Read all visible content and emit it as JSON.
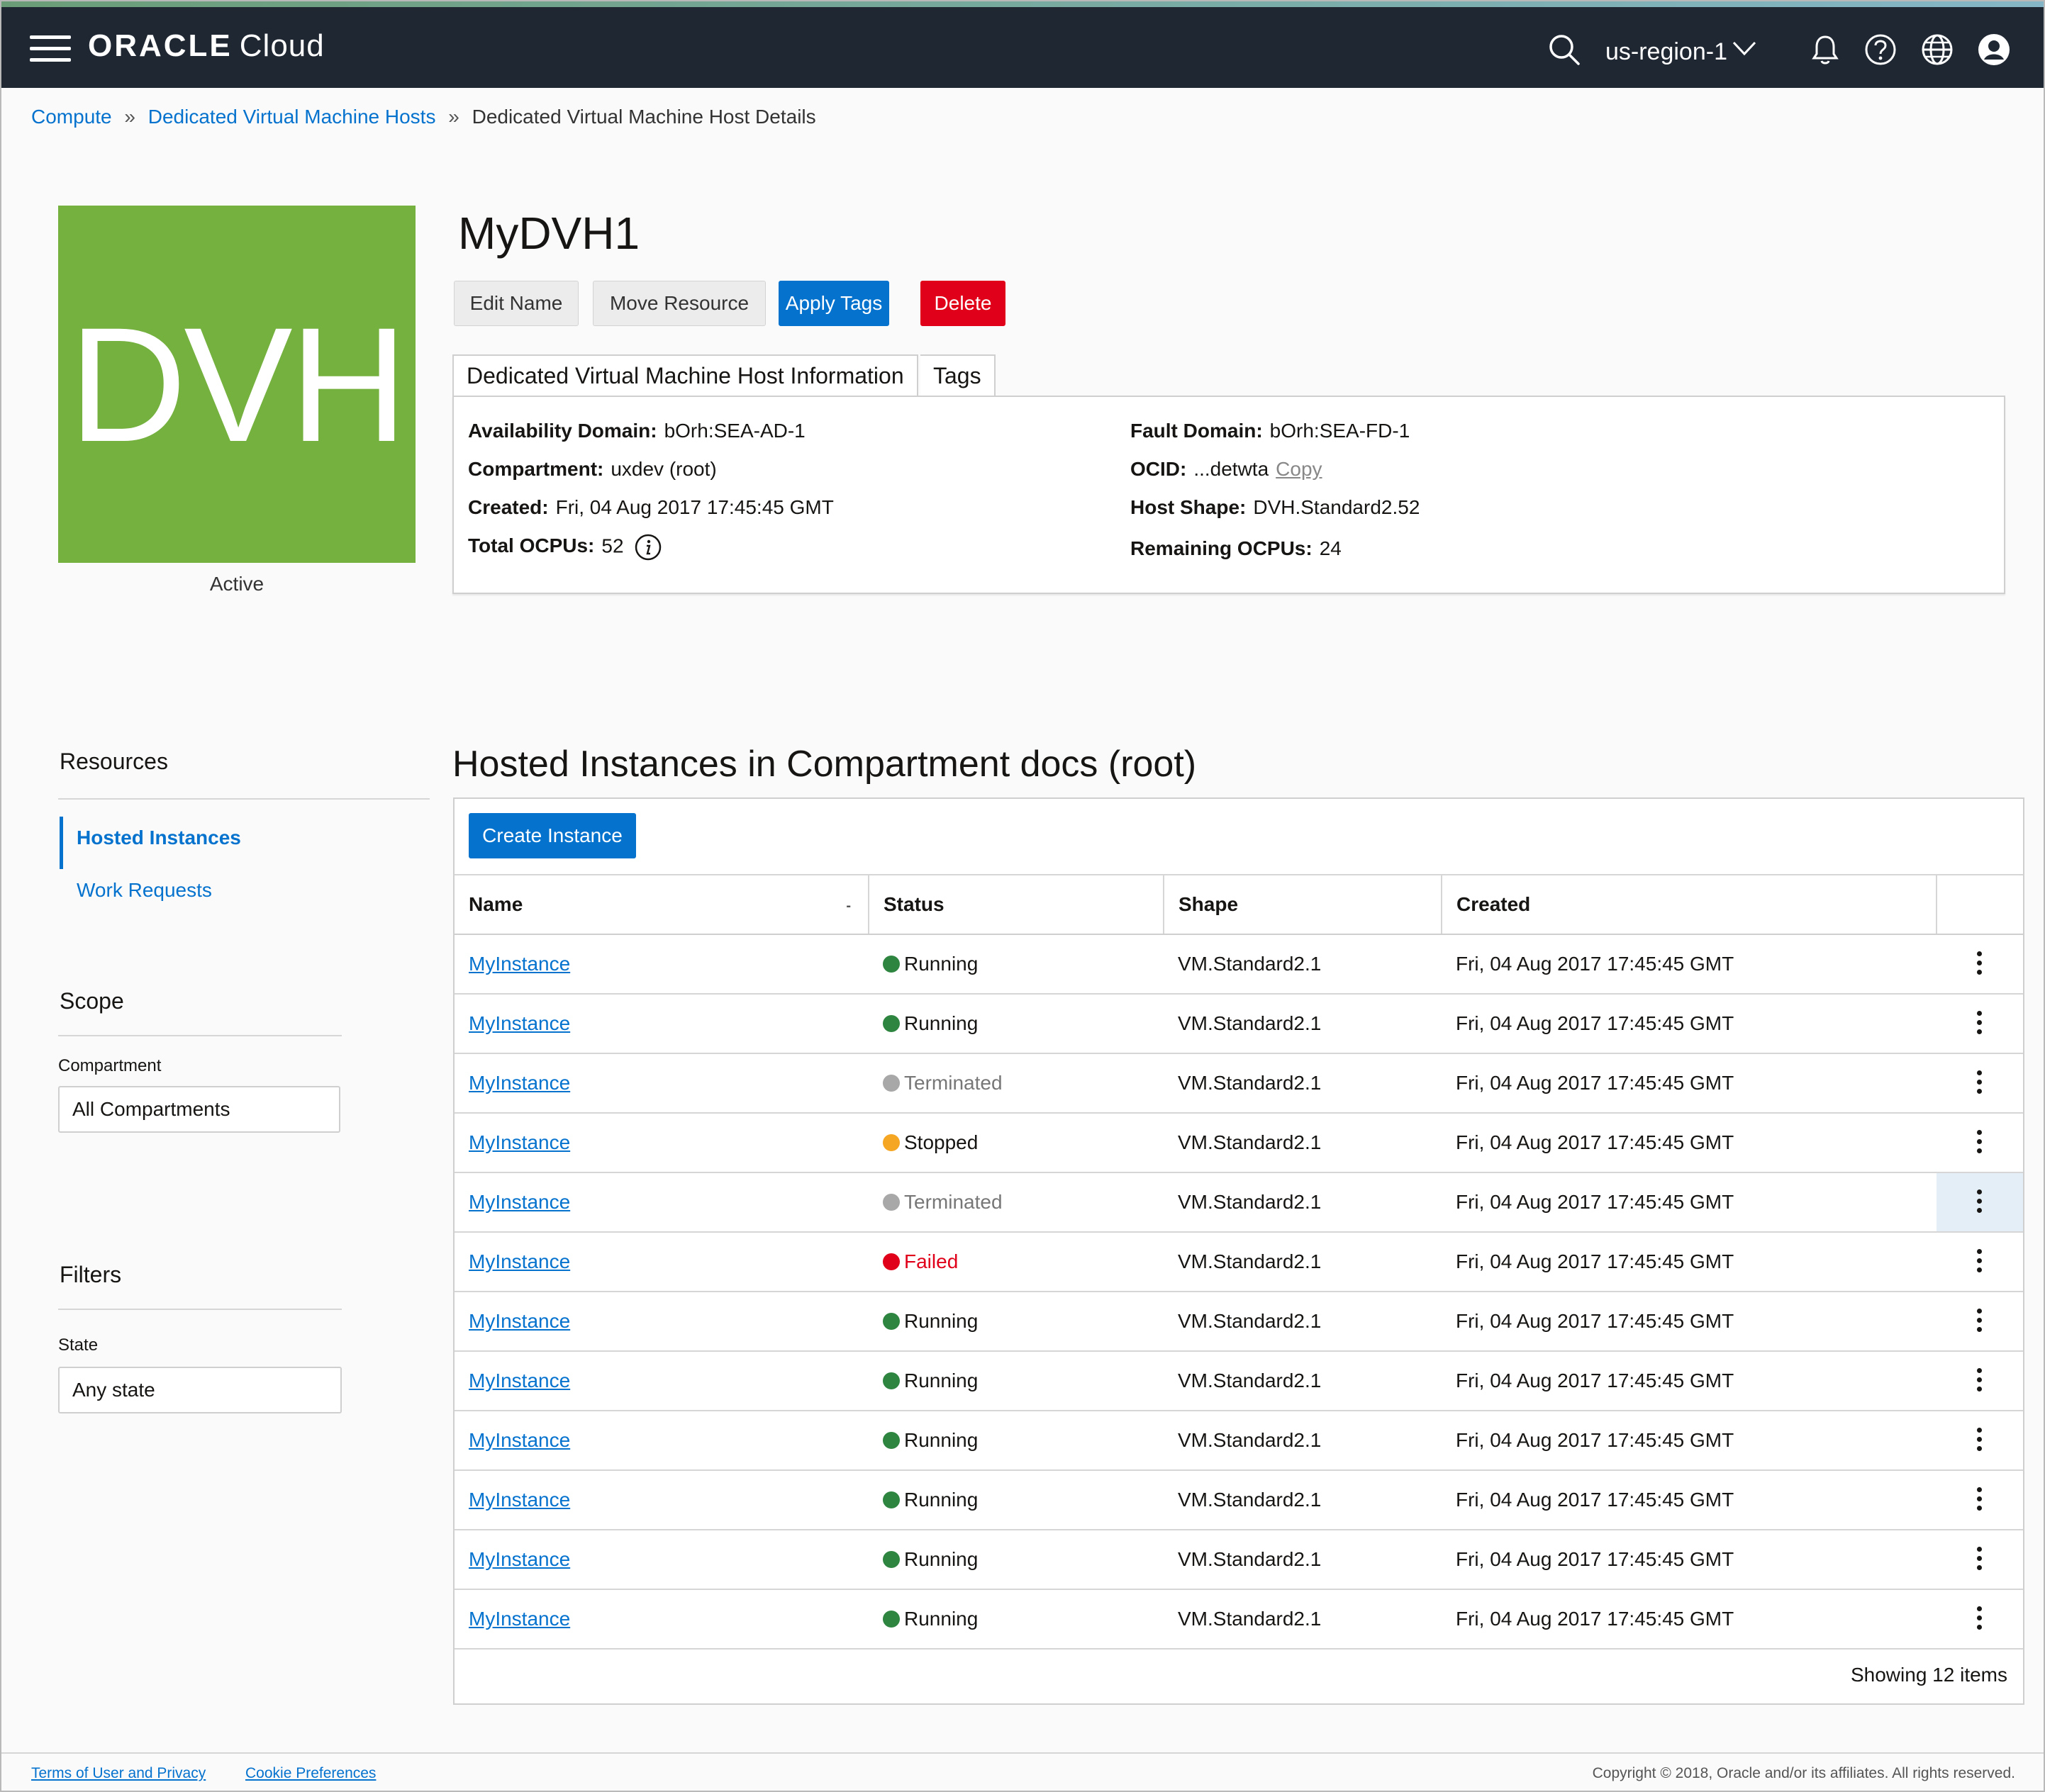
{
  "header": {
    "brand_main": "ORACLE",
    "brand_sub": "Cloud",
    "region": "us-region-1",
    "icons": [
      "menu-icon",
      "search-icon",
      "chevron-down-icon",
      "bell-icon",
      "help-icon",
      "globe-icon",
      "user-icon"
    ]
  },
  "breadcrumb": {
    "items": [
      "Compute",
      "Dedicated Virtual Machine Hosts"
    ],
    "separator": "»",
    "current": "Dedicated Virtual Machine Host Details"
  },
  "resource": {
    "tile_text": "DVH",
    "tile_color": "#75b13f",
    "status": "Active",
    "name": "MyDVH1"
  },
  "actions": {
    "edit_name": "Edit Name",
    "move_resource": "Move Resource",
    "apply_tags": "Apply Tags",
    "delete": "Delete"
  },
  "tabs": [
    "Dedicated Virtual Machine Host Information",
    "Tags"
  ],
  "info": {
    "availability_domain": {
      "label": "Availability Domain:",
      "value": "bOrh:SEA-AD-1"
    },
    "compartment": {
      "label": "Compartment:",
      "value": "uxdev (root)"
    },
    "created": {
      "label": "Created:",
      "value": "Fri, 04 Aug 2017 17:45:45 GMT"
    },
    "total_ocpus": {
      "label": "Total OCPUs:",
      "value": "52"
    },
    "fault_domain": {
      "label": "Fault Domain:",
      "value": "bOrh:SEA-FD-1"
    },
    "ocid": {
      "label": "OCID:",
      "value": "...detwta",
      "copy": "Copy"
    },
    "host_shape": {
      "label": "Host Shape:",
      "value": "DVH.Standard2.52"
    },
    "remaining_ocpus": {
      "label": "Remaining OCPUs:",
      "value": "24"
    }
  },
  "sidebar": {
    "resources_heading": "Resources",
    "links": [
      "Hosted Instances",
      "Work Requests"
    ],
    "scope_heading": "Scope",
    "compartment_label": "Compartment",
    "compartment_value": "All Compartments",
    "filters_heading": "Filters",
    "state_label": "State",
    "state_value": "Any state"
  },
  "list": {
    "title": "Hosted Instances in Compartment docs (root)",
    "create_button": "Create Instance",
    "columns": [
      "Name",
      "Status",
      "Shape",
      "Created"
    ],
    "sort_indicator": "-",
    "rows": [
      {
        "name": "MyInstance",
        "status": "Running",
        "state": "running",
        "shape": "VM.Standard2.1",
        "created": "Fri, 04 Aug 2017 17:45:45 GMT"
      },
      {
        "name": "MyInstance",
        "status": "Running",
        "state": "running",
        "shape": "VM.Standard2.1",
        "created": "Fri, 04 Aug 2017 17:45:45 GMT"
      },
      {
        "name": "MyInstance",
        "status": "Terminated",
        "state": "terminated",
        "shape": "VM.Standard2.1",
        "created": "Fri, 04 Aug 2017 17:45:45 GMT"
      },
      {
        "name": "MyInstance",
        "status": "Stopped",
        "state": "stopped",
        "shape": "VM.Standard2.1",
        "created": "Fri, 04 Aug 2017 17:45:45 GMT"
      },
      {
        "name": "MyInstance",
        "status": "Terminated",
        "state": "terminated",
        "shape": "VM.Standard2.1",
        "created": "Fri, 04 Aug 2017 17:45:45 GMT"
      },
      {
        "name": "MyInstance",
        "status": "Failed",
        "state": "failed",
        "shape": "VM.Standard2.1",
        "created": "Fri, 04 Aug 2017 17:45:45 GMT"
      },
      {
        "name": "MyInstance",
        "status": "Running",
        "state": "running",
        "shape": "VM.Standard2.1",
        "created": "Fri, 04 Aug 2017 17:45:45 GMT"
      },
      {
        "name": "MyInstance",
        "status": "Running",
        "state": "running",
        "shape": "VM.Standard2.1",
        "created": "Fri, 04 Aug 2017 17:45:45 GMT"
      },
      {
        "name": "MyInstance",
        "status": "Running",
        "state": "running",
        "shape": "VM.Standard2.1",
        "created": "Fri, 04 Aug 2017 17:45:45 GMT"
      },
      {
        "name": "MyInstance",
        "status": "Running",
        "state": "running",
        "shape": "VM.Standard2.1",
        "created": "Fri, 04 Aug 2017 17:45:45 GMT"
      },
      {
        "name": "MyInstance",
        "status": "Running",
        "state": "running",
        "shape": "VM.Standard2.1",
        "created": "Fri, 04 Aug 2017 17:45:45 GMT"
      },
      {
        "name": "MyInstance",
        "status": "Running",
        "state": "running",
        "shape": "VM.Standard2.1",
        "created": "Fri, 04 Aug 2017 17:45:45 GMT"
      }
    ],
    "highlighted_row": 5,
    "status_colors": {
      "running": "#2e8540",
      "terminated": "#a8a8a8",
      "stopped": "#f5a623",
      "failed": "#e0001a"
    },
    "footer_text": "Showing 12 items"
  },
  "footer": {
    "terms": "Terms of User and Privacy",
    "cookies": "Cookie Preferences",
    "copyright": "Copyright © 2018, Oracle and/or its affiliates. All rights reserved."
  }
}
